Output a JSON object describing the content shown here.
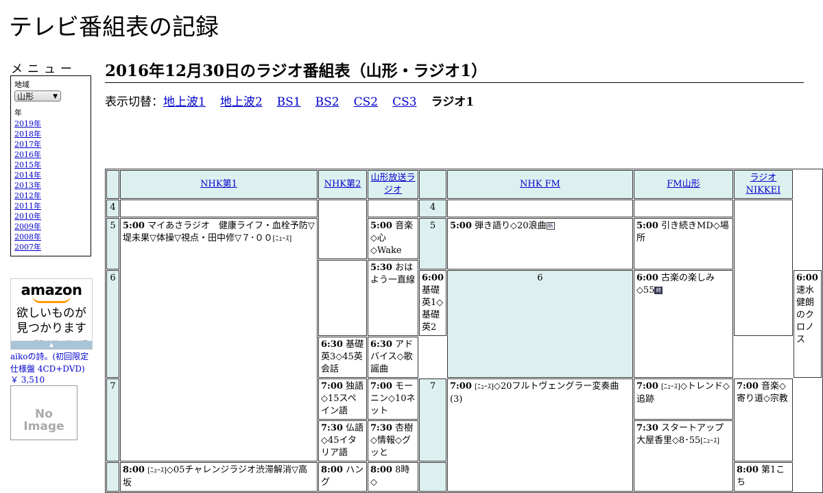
{
  "site": {
    "title": "テレビ番組表の記録"
  },
  "sidebar": {
    "menu_heading": "メニュー",
    "region_label": "地域",
    "region_value": "山形",
    "year_label": "年",
    "years": [
      "2019年",
      "2018年",
      "2017年",
      "2016年",
      "2015年",
      "2014年",
      "2013年",
      "2012年",
      "2011年",
      "2010年",
      "2009年",
      "2008年",
      "2007年"
    ]
  },
  "ad": {
    "brand": "amazon",
    "message_line1": "欲しいものが",
    "message_line2": "見つかります",
    "privacy": "プライバシーについて",
    "product_title": "aikoの詩。(初回限定仕様盤 4CD+DVD)",
    "product_price": "￥ 3,510",
    "no_image_line1": "No",
    "no_image_line2": "Image"
  },
  "main": {
    "heading": "2016年12月30日のラジオ番組表（山形・ラジオ1）",
    "switch_label": "表示切替：",
    "switch_links": [
      "地上波1",
      "地上波2",
      "BS1",
      "BS2",
      "CS2",
      "CS3"
    ],
    "switch_current": "ラジオ1"
  },
  "channels": [
    "NHK第1",
    "NHK第2",
    "山形放送ラジオ",
    "NHK FM",
    "FM山形",
    "ラジオNIKKEI"
  ],
  "hours": [
    "4",
    "5",
    "6",
    "7"
  ],
  "programs": {
    "nhk1_500_time": "5:00",
    "nhk1_500_title": "マイあさラジオ　健康ライフ・血栓予防▽堤未果▽体操▽視点・田中修▽７･００",
    "nhk1_800_time": "8:00",
    "nhk1_800_title": "◇05チャレンジラジオ渋滞解消▽高坂",
    "nhk2_600_time": "6:00",
    "nhk2_600_title": "基礎英1◇基礎英2",
    "nhk2_630_time": "6:30",
    "nhk2_630_title": "基礎英3◇45英会話",
    "nhk2_700_time": "7:00",
    "nhk2_700_title": "独語◇15スペイン語",
    "nhk2_730_time": "7:30",
    "nhk2_730_title": "仏語◇45イタリア語",
    "nhk2_800_time": "8:00",
    "nhk2_800_title": "ハング",
    "ybc_500_time": "5:00",
    "ybc_500_title": "音楽◇心◇Wake",
    "ybc_530_time": "5:30",
    "ybc_530_title": "おはよう一直線",
    "ybc_630_time": "6:30",
    "ybc_630_title": "アドバイス◇歌謡曲",
    "ybc_700_time": "7:00",
    "ybc_700_title": "モーニン◇10ネット",
    "ybc_730_time": "7:30",
    "ybc_730_title": "杏樹◇情報◇グッと",
    "ybc_800_time": "8:00",
    "ybc_800_title": "8時◇",
    "fm_500_time": "5:00",
    "fm_500_title": "弾き語り◇20浪曲",
    "fm_600_time": "6:00",
    "fm_600_title": "古楽の楽しみ◇55",
    "fm_700_time": "7:00",
    "fm_700_title": "◇20フルトヴェングラー変奏曲(3)",
    "fmy_500_time": "5:00",
    "fmy_500_title": "引き続きMD◇場所",
    "fmy_600_time": "6:00",
    "fmy_600_title": "速水健朗のクロノス",
    "fmy_700_time": "7:00",
    "fmy_700_title": "◇トレンド◇追跡",
    "fmy_730_time": "7:30",
    "fmy_730_title": "スタートアップ大屋香里◇8･55",
    "nikkei_700_time": "7:00",
    "nikkei_700_title": "音楽◇寄り道◇宗教",
    "nikkei_800_time": "8:00",
    "nikkei_800_title": "第1こち",
    "news_tag": "[ﾆｭｰｽ]",
    "badge_new": "新",
    "badge_end": "終"
  },
  "colors": {
    "link": "#0000cc",
    "header_bg": "#ddf0f0",
    "amazon_orange": "#ff9900"
  }
}
